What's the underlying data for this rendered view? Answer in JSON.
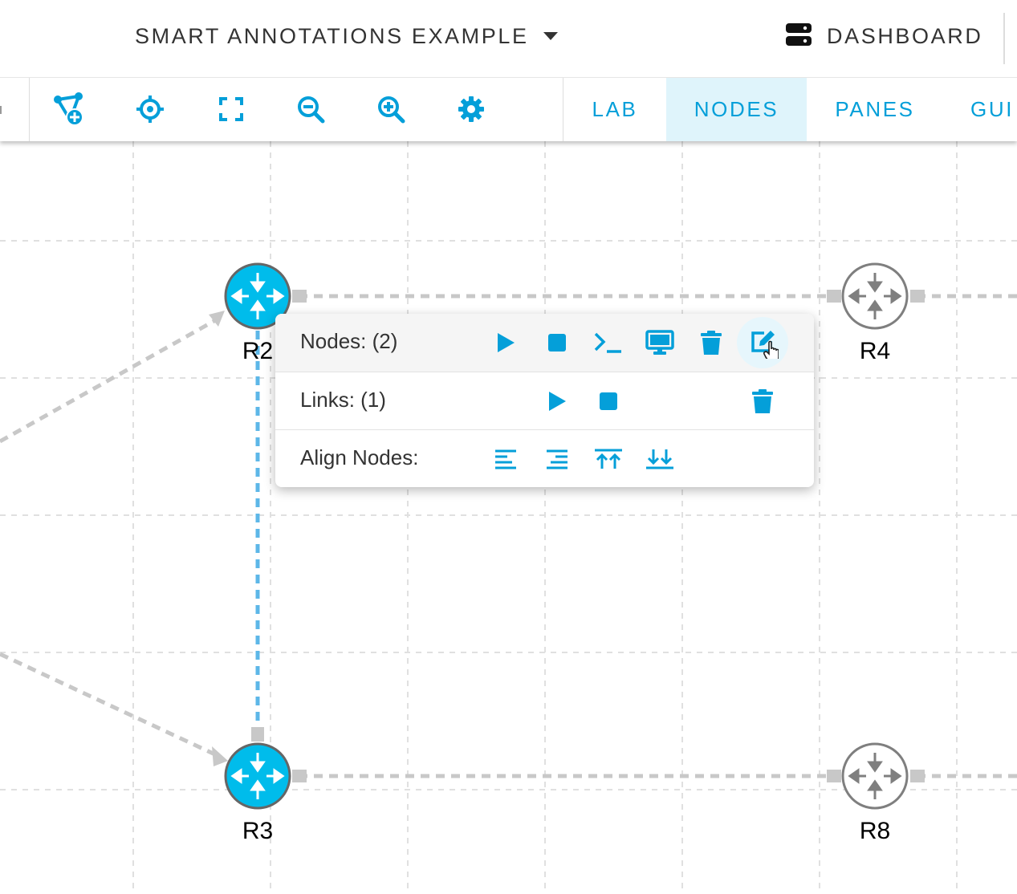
{
  "header": {
    "lab_title": "SMART ANNOTATIONS EXAMPLE",
    "dashboard_label": "DASHBOARD"
  },
  "toolbar": {
    "icons": [
      "add-node-icon",
      "crosshair-icon",
      "fit-screen-icon",
      "zoom-out-icon",
      "zoom-in-icon",
      "settings-gear-icon"
    ],
    "tabs": [
      {
        "label": "LAB",
        "active": false
      },
      {
        "label": "NODES",
        "active": true
      },
      {
        "label": "PANES",
        "active": false
      },
      {
        "label": "GUI",
        "active": false
      }
    ]
  },
  "topology": {
    "nodes": [
      {
        "name": "R2",
        "selected": true
      },
      {
        "name": "R4",
        "selected": false
      },
      {
        "name": "R3",
        "selected": true
      },
      {
        "name": "R8",
        "selected": false
      }
    ]
  },
  "popup": {
    "nodes_label": "Nodes: (2)",
    "links_label": "Links: (1)",
    "align_label": "Align Nodes:",
    "node_actions": [
      "play-icon",
      "stop-icon",
      "console-icon",
      "monitor-icon",
      "trash-icon",
      "edit-icon"
    ],
    "link_actions": [
      "play-icon",
      "stop-icon",
      "trash-icon"
    ],
    "align_actions": [
      "align-left-icon",
      "align-right-icon",
      "align-top-icon",
      "align-bottom-icon"
    ]
  },
  "colors": {
    "accent": "#049fd9",
    "node_selected": "#00bceb",
    "node_unselected_stroke": "#7f7f7f",
    "link_grey": "#c8c8c8",
    "link_selected": "#5db7e8",
    "grid": "#e2e2e2"
  }
}
